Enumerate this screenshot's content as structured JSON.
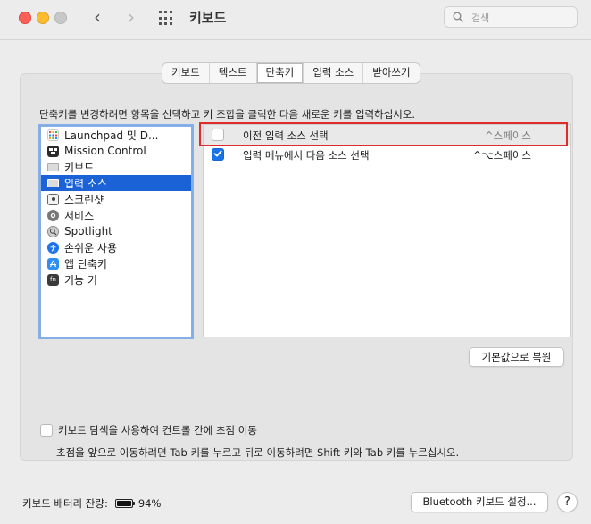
{
  "window": {
    "title": "키보드"
  },
  "search": {
    "placeholder": "검색"
  },
  "tabs": [
    {
      "label": "키보드"
    },
    {
      "label": "텍스트"
    },
    {
      "label": "단축키",
      "active": true
    },
    {
      "label": "입력 소스"
    },
    {
      "label": "받아쓰기"
    }
  ],
  "instruction": "단축키를 변경하려면 항목을 선택하고 키 조합을 클릭한 다음 새로운 키를 입력하십시오.",
  "categories": [
    {
      "label": "Launchpad 및 D...",
      "icon": "launchpad-icon"
    },
    {
      "label": "Mission Control",
      "icon": "mission-control-icon"
    },
    {
      "label": "키보드",
      "icon": "keyboard-icon"
    },
    {
      "label": "입력 소스",
      "icon": "input-source-icon",
      "selected": true
    },
    {
      "label": "스크린샷",
      "icon": "screenshot-icon"
    },
    {
      "label": "서비스",
      "icon": "services-gear-icon"
    },
    {
      "label": "Spotlight",
      "icon": "spotlight-icon"
    },
    {
      "label": "손쉬운 사용",
      "icon": "accessibility-icon"
    },
    {
      "label": "앱 단축키",
      "icon": "app-store-icon"
    },
    {
      "label": "기능 키",
      "icon": "fn-key-icon"
    }
  ],
  "shortcuts": [
    {
      "name": "이전 입력 소스 선택",
      "keys": "^스페이스",
      "checked": false
    },
    {
      "name": "입력 메뉴에서 다음 소스 선택",
      "keys": "^⌥스페이스",
      "checked": true
    }
  ],
  "buttons": {
    "restore": "기본값으로 복원",
    "bluetooth": "Bluetooth 키보드 설정...",
    "help": "?"
  },
  "keyboard_navigation": {
    "label": "키보드 탐색을 사용하여 컨트롤 간에 초점 이동",
    "checked": false,
    "hint": "초점을 앞으로 이동하려면 Tab 키를 누르고 뒤로 이동하려면 Shift 키와 Tab 키를 누르십시오."
  },
  "battery": {
    "label": "키보드 배터리 잔량:",
    "value": "94%",
    "level": 0.94
  },
  "colors": {
    "selection": "#1a62d6",
    "checkbox_on": "#1a73e8",
    "highlight_frame": "#e02b2b"
  }
}
